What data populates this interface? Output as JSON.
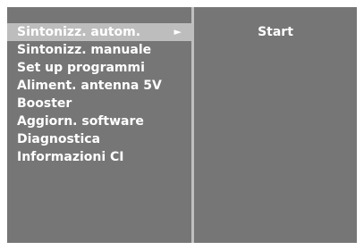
{
  "menu": {
    "items": [
      {
        "label": "Sintonizz. autom.",
        "selected": true,
        "has_submenu": true
      },
      {
        "label": "Sintonizz. manuale",
        "selected": false
      },
      {
        "label": "Set up programmi",
        "selected": false
      },
      {
        "label": "Aliment. antenna 5V",
        "selected": false
      },
      {
        "label": "Booster",
        "selected": false
      },
      {
        "label": "Aggiorn. software",
        "selected": false
      },
      {
        "label": "Diagnostica",
        "selected": false
      },
      {
        "label": "Informazioni CI",
        "selected": false
      }
    ],
    "submenu_arrow": "►"
  },
  "submenu": {
    "value": "Start"
  },
  "colors": {
    "panel": "#767676",
    "frame": "#bfbfbf",
    "highlight": "#bdbdbd",
    "text": "#ffffff"
  },
  "icons": {
    "submenu_indicator": "triangle-right-icon"
  }
}
